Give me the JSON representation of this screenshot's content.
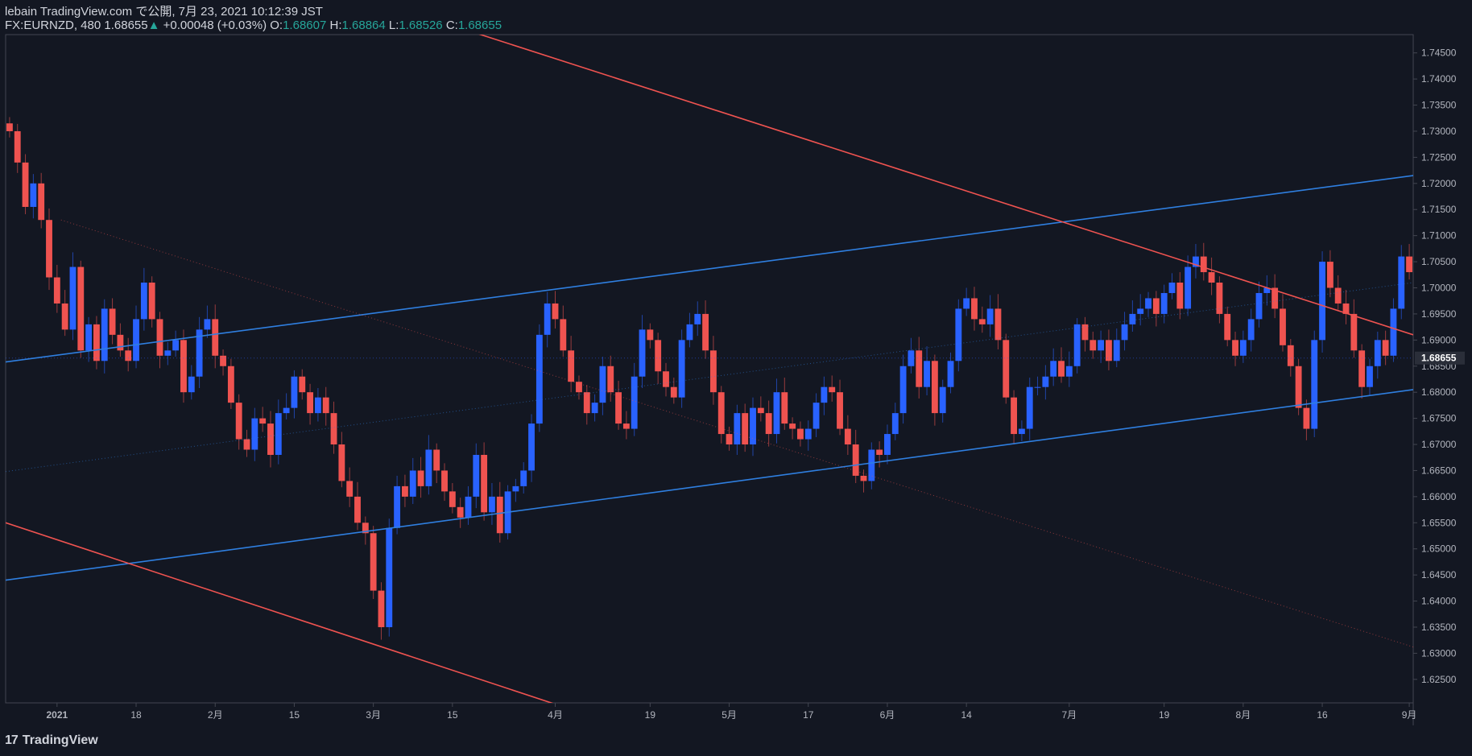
{
  "header": {
    "line1": "lebain TradingView.com で公開, 7月 23, 2021 10:12:39 JST",
    "symbol": "FX:EURNZD, 480",
    "last": "1.68655",
    "change_arrow": "▲",
    "change": "+0.00048 (+0.03%)",
    "o_label": "O:",
    "o": "1.68607",
    "h_label": "H:",
    "h": "1.68864",
    "l_label": "L:",
    "l": "1.68526",
    "c_label": "C:",
    "c": "1.68655"
  },
  "footer": {
    "logo_glyph": "17",
    "brand": "TradingView"
  },
  "colors": {
    "background": "#131722",
    "up_candle": "#2962ff",
    "down_candle": "#ef5350",
    "blue_line": "#2f7fe0",
    "red_line": "#ef5350",
    "axis_text": "#b2b5be",
    "header_value": "#26a69a"
  },
  "chart_data": {
    "type": "candlestick",
    "symbol": "FX:EURNZD",
    "interval": "480",
    "last_price": 1.68655,
    "ylim": [
      1.6205,
      1.7485
    ],
    "y_ticks": [
      "1.74500",
      "1.74000",
      "1.73500",
      "1.73000",
      "1.72500",
      "1.72000",
      "1.71500",
      "1.71000",
      "1.70500",
      "1.70000",
      "1.69500",
      "1.69000",
      "1.68500",
      "1.68000",
      "1.67500",
      "1.67000",
      "1.66500",
      "1.66000",
      "1.65500",
      "1.65000",
      "1.64500",
      "1.64000",
      "1.63500",
      "1.63000",
      "1.62500"
    ],
    "y_tick_values": [
      1.745,
      1.74,
      1.735,
      1.73,
      1.725,
      1.72,
      1.715,
      1.71,
      1.705,
      1.7,
      1.695,
      1.69,
      1.685,
      1.68,
      1.675,
      1.67,
      1.665,
      1.66,
      1.655,
      1.65,
      1.645,
      1.64,
      1.635,
      1.63,
      1.625
    ],
    "x_ticks": [
      {
        "label": "2021",
        "bar": 6
      },
      {
        "label": "18",
        "bar": 16
      },
      {
        "label": "2月",
        "bar": 26
      },
      {
        "label": "15",
        "bar": 36
      },
      {
        "label": "3月",
        "bar": 46
      },
      {
        "label": "15",
        "bar": 56
      },
      {
        "label": "4月",
        "bar": 69
      },
      {
        "label": "19",
        "bar": 81
      },
      {
        "label": "5月",
        "bar": 91
      },
      {
        "label": "17",
        "bar": 101
      },
      {
        "label": "6月",
        "bar": 111
      },
      {
        "label": "14",
        "bar": 121
      },
      {
        "label": "7月",
        "bar": 134
      },
      {
        "label": "19",
        "bar": 146
      },
      {
        "label": "8月",
        "bar": 156
      },
      {
        "label": "16",
        "bar": 166
      },
      {
        "label": "9月",
        "bar": 177
      }
    ],
    "total_bars": 178,
    "closes": [
      1.73,
      1.724,
      1.7155,
      1.72,
      1.713,
      1.702,
      1.697,
      1.692,
      1.704,
      1.688,
      1.693,
      1.686,
      1.696,
      1.691,
      1.688,
      1.686,
      1.694,
      1.701,
      1.694,
      1.687,
      1.688,
      1.69,
      1.68,
      1.683,
      1.692,
      1.694,
      1.687,
      1.685,
      1.678,
      1.671,
      1.669,
      1.675,
      1.674,
      1.668,
      1.676,
      1.677,
      1.683,
      1.68,
      1.676,
      1.679,
      1.676,
      1.67,
      1.663,
      1.66,
      1.655,
      1.653,
      1.642,
      1.635,
      1.654,
      1.662,
      1.66,
      1.665,
      1.662,
      1.669,
      1.665,
      1.661,
      1.658,
      1.656,
      1.66,
      1.668,
      1.657,
      1.66,
      1.653,
      1.661,
      1.662,
      1.665,
      1.674,
      1.691,
      1.697,
      1.694,
      1.688,
      1.682,
      1.68,
      1.676,
      1.678,
      1.685,
      1.68,
      1.674,
      1.673,
      1.683,
      1.692,
      1.69,
      1.684,
      1.681,
      1.679,
      1.69,
      1.693,
      1.695,
      1.688,
      1.68,
      1.672,
      1.67,
      1.676,
      1.67,
      1.677,
      1.676,
      1.672,
      1.68,
      1.674,
      1.673,
      1.671,
      1.673,
      1.678,
      1.681,
      1.68,
      1.673,
      1.67,
      1.664,
      1.663,
      1.669,
      1.668,
      1.672,
      1.676,
      1.685,
      1.688,
      1.681,
      1.686,
      1.676,
      1.681,
      1.686,
      1.696,
      1.698,
      1.694,
      1.693,
      1.696,
      1.69,
      1.679,
      1.672,
      1.673,
      1.681,
      1.681,
      1.683,
      1.686,
      1.683,
      1.685,
      1.693,
      1.69,
      1.688,
      1.69,
      1.686,
      1.69,
      1.693,
      1.695,
      1.696,
      1.698,
      1.695,
      1.699,
      1.701,
      1.696,
      1.704,
      1.706,
      1.703,
      1.701,
      1.695,
      1.69,
      1.687,
      1.69,
      1.694,
      1.699,
      1.7,
      1.696,
      1.689,
      1.685,
      1.677,
      1.673,
      1.69,
      1.705,
      1.7,
      1.697,
      1.695,
      1.688,
      1.681,
      1.685,
      1.69,
      1.687,
      1.696,
      1.706,
      1.703,
      1.698,
      1.692,
      1.689,
      1.6866
    ],
    "drawn_lines": [
      {
        "name": "channel-upper",
        "color": "blue",
        "x": [
          0,
          178
        ],
        "y": [
          1.6858,
          1.7215
        ]
      },
      {
        "name": "channel-lower",
        "color": "blue",
        "x": [
          0,
          178
        ],
        "y": [
          1.644,
          1.6805
        ]
      },
      {
        "name": "channel-mid",
        "color": "blue-dotted",
        "x": [
          0,
          178
        ],
        "y": [
          1.6648,
          1.701
        ]
      },
      {
        "name": "downtrend-upper",
        "color": "red",
        "x": [
          57,
          178
        ],
        "y": [
          1.75,
          1.691
        ]
      },
      {
        "name": "downtrend-lower",
        "color": "red",
        "x": [
          0,
          70
        ],
        "y": [
          1.655,
          1.62
        ]
      },
      {
        "name": "downtrend-mid",
        "color": "red-dotted",
        "x": [
          7,
          178
        ],
        "y": [
          1.713,
          1.6312
        ]
      }
    ]
  }
}
